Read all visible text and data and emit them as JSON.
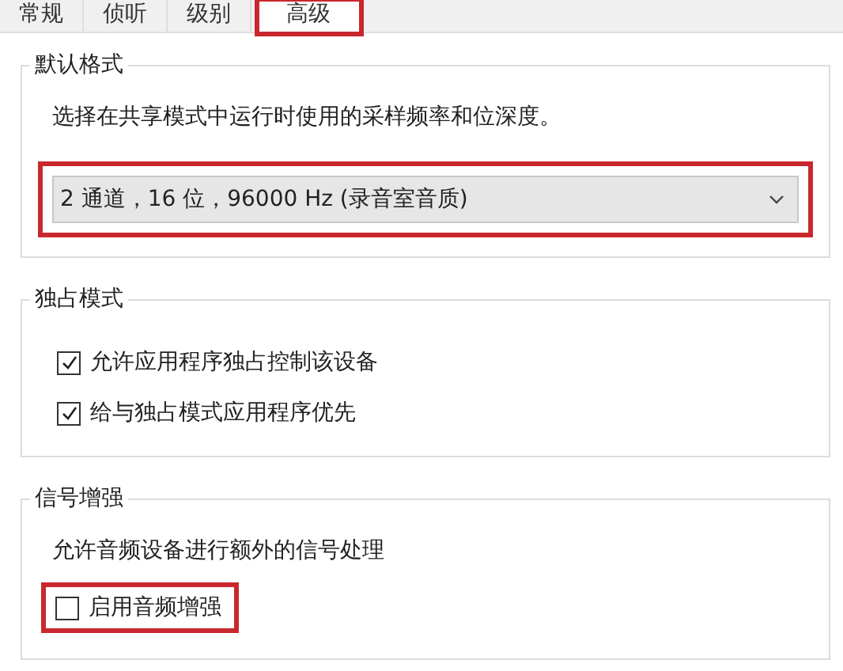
{
  "tabs": [
    {
      "label": "常规",
      "selected": false,
      "highlighted": false
    },
    {
      "label": "侦听",
      "selected": false,
      "highlighted": false
    },
    {
      "label": "级别",
      "selected": false,
      "highlighted": false
    },
    {
      "label": "高级",
      "selected": true,
      "highlighted": true
    }
  ],
  "groups": [
    {
      "title": "默认格式",
      "items": [
        {
          "kind": "text",
          "text": "选择在共享模式中运行时使用的采样频率和位深度。"
        },
        {
          "kind": "dropdown",
          "value": "2 通道，16 位，96000 Hz (录音室音质)",
          "highlighted": true
        }
      ]
    },
    {
      "title": "独占模式",
      "items": [
        {
          "kind": "checkbox",
          "label": "允许应用程序独占控制该设备",
          "checked": true,
          "highlighted": false
        },
        {
          "kind": "checkbox",
          "label": "给与独占模式应用程序优先",
          "checked": true,
          "highlighted": false
        }
      ]
    },
    {
      "title": "信号增强",
      "items": [
        {
          "kind": "text",
          "text": "允许音频设备进行额外的信号处理"
        },
        {
          "kind": "checkbox",
          "label": "启用音频增强",
          "checked": false,
          "highlighted": true
        }
      ]
    }
  ]
}
